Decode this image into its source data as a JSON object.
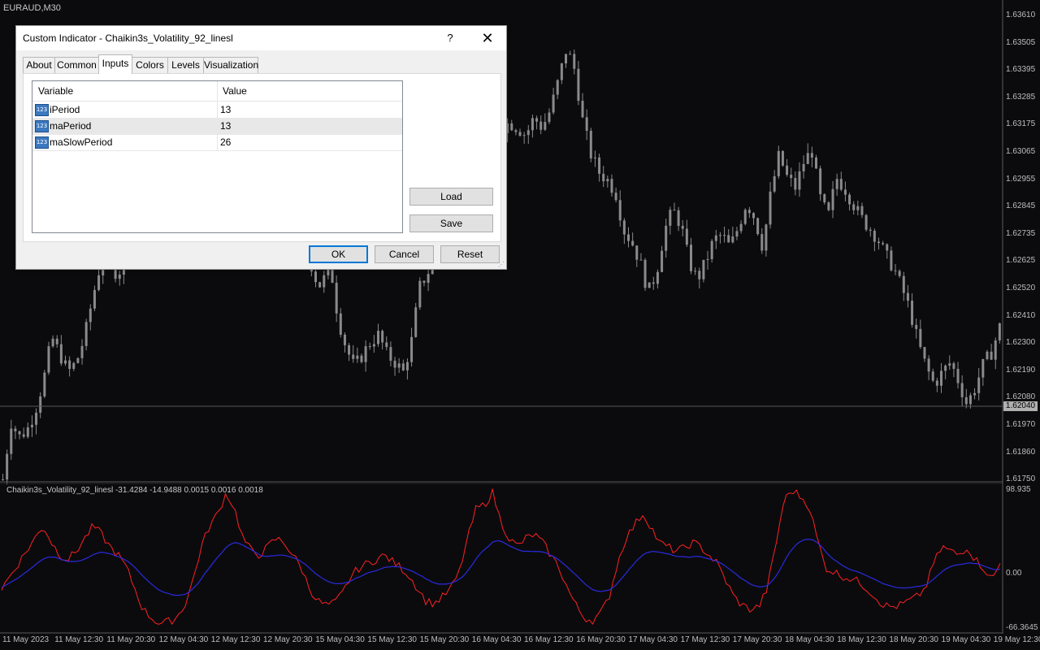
{
  "chart": {
    "symbol_label": "EURAUD,M30",
    "price_ticks": [
      "1.63610",
      "1.63505",
      "1.63395",
      "1.63285",
      "1.63175",
      "1.63065",
      "1.62955",
      "1.62845",
      "1.62735",
      "1.62625",
      "1.62520",
      "1.62410",
      "1.62300",
      "1.62190",
      "1.62080",
      "1.61970",
      "1.61860",
      "1.61750"
    ],
    "current_price": "1.62040",
    "indicator_label": "Chaikin3s_Volatility_92_linesl -31.4284 -14.9488 0.0015 0.0016 0.0018",
    "indicator_ticks": [
      "98.935",
      "0.00",
      "-66.3645"
    ],
    "time_ticks": [
      "11 May 2023",
      "11 May 12:30",
      "11 May 20:30",
      "12 May 04:30",
      "12 May 12:30",
      "12 May 20:30",
      "15 May 04:30",
      "15 May 12:30",
      "15 May 20:30",
      "16 May 04:30",
      "16 May 12:30",
      "16 May 20:30",
      "17 May 04:30",
      "17 May 12:30",
      "17 May 20:30",
      "18 May 04:30",
      "18 May 12:30",
      "18 May 20:30",
      "19 May 04:30",
      "19 May 12:30"
    ],
    "colors": {
      "background": "#0b0b0e",
      "candles": "#8a8a8a",
      "red_line": "#ff2020",
      "blue_line": "#2a2ae0",
      "grid": "#3a3a3a"
    },
    "price_path": [
      1.6175,
      1.6198,
      1.6192,
      1.6195,
      1.6203,
      1.6215,
      1.6232,
      1.6225,
      1.6218,
      1.6222,
      1.6232,
      1.6248,
      1.6262,
      1.627,
      1.6255,
      1.6268,
      1.628,
      1.6262,
      1.627,
      1.6283,
      1.6292,
      1.6288,
      1.6298,
      1.6305,
      1.6312,
      1.6301,
      1.6316,
      1.6295,
      1.6306,
      1.6312,
      1.6302,
      1.6291,
      1.6283,
      1.6275,
      1.6268,
      1.6282,
      1.626,
      1.6274,
      1.6257,
      1.6252,
      1.6263,
      1.624,
      1.6228,
      1.622,
      1.6225,
      1.623,
      1.6233,
      1.6225,
      1.6222,
      1.6218,
      1.623,
      1.6252,
      1.6258,
      1.6262,
      1.6268,
      1.6275,
      1.6282,
      1.6293,
      1.63,
      1.6305,
      1.6312,
      1.6316,
      1.6318,
      1.6316,
      1.6313,
      1.632,
      1.6316,
      1.6323,
      1.6335,
      1.6348,
      1.6339,
      1.6318,
      1.6305,
      1.6298,
      1.6295,
      1.629,
      1.6275,
      1.627,
      1.6262,
      1.625,
      1.6258,
      1.6275,
      1.6283,
      1.6277,
      1.6262,
      1.6255,
      1.6262,
      1.6271,
      1.6273,
      1.6268,
      1.6276,
      1.6286,
      1.628,
      1.6268,
      1.629,
      1.6305,
      1.6296,
      1.6292,
      1.6302,
      1.6307,
      1.6288,
      1.628,
      1.6296,
      1.6292,
      1.6286,
      1.628,
      1.6276,
      1.6272,
      1.6265,
      1.626,
      1.6252,
      1.6243,
      1.623,
      1.622,
      1.6213,
      1.6218,
      1.6222,
      1.6214,
      1.6205,
      1.6212,
      1.6221,
      1.6226,
      1.6236
    ],
    "red_path": [
      -20,
      -5,
      10,
      25,
      40,
      55,
      35,
      20,
      15,
      25,
      40,
      55,
      45,
      30,
      20,
      5,
      -20,
      -45,
      -55,
      -62,
      -60,
      -55,
      -40,
      -10,
      30,
      55,
      70,
      95,
      75,
      40,
      25,
      20,
      30,
      40,
      35,
      20,
      5,
      -20,
      -35,
      -40,
      -38,
      -25,
      -5,
      5,
      10,
      15,
      20,
      12,
      5,
      -5,
      -20,
      -35,
      -38,
      -30,
      -20,
      0,
      40,
      75,
      80,
      95,
      60,
      40,
      30,
      40,
      45,
      35,
      20,
      5,
      -20,
      -40,
      -55,
      -58,
      -50,
      -30,
      10,
      40,
      55,
      70,
      55,
      35,
      30,
      25,
      28,
      35,
      30,
      20,
      10,
      -10,
      -30,
      -40,
      -45,
      -42,
      -20,
      30,
      85,
      98,
      90,
      80,
      40,
      5,
      0,
      -5,
      -8,
      -12,
      -20,
      -30,
      -40,
      -42,
      -40,
      -35,
      -30,
      -20,
      10,
      30,
      25,
      20,
      30,
      15,
      5,
      -10,
      10
    ]
  },
  "dialog": {
    "title": "Custom Indicator - Chaikin3s_Volatility_92_linesl",
    "help_label": "?",
    "close_label": "✕",
    "tabs": [
      "About",
      "Common",
      "Inputs",
      "Colors",
      "Levels",
      "Visualization"
    ],
    "active_tab": "Inputs",
    "grid": {
      "headers": [
        "Variable",
        "Value"
      ],
      "icon_text": "123",
      "rows": [
        {
          "name": "iPeriod",
          "value": "13"
        },
        {
          "name": "maPeriod",
          "value": "13"
        },
        {
          "name": "maSlowPeriod",
          "value": "26"
        }
      ]
    },
    "load_label": "Load",
    "save_label": "Save",
    "ok_label": "OK",
    "cancel_label": "Cancel",
    "reset_label": "Reset"
  }
}
